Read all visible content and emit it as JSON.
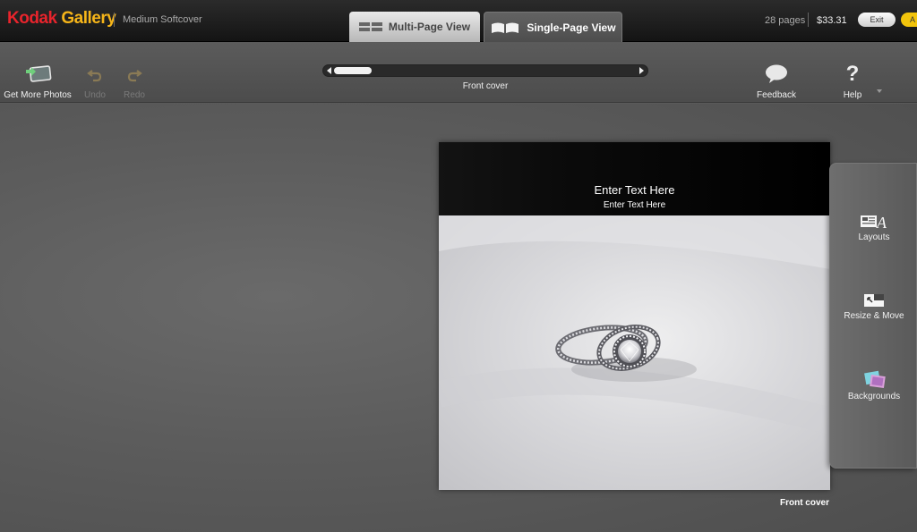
{
  "header": {
    "brand_primary": "Kodak",
    "brand_secondary": "Gallery",
    "brand_primary_color": "#e8242c",
    "brand_secondary_color": "#f6b519",
    "product": "Medium Softcover",
    "tabs": [
      {
        "label": "Multi-Page View",
        "icon": "grid-icon",
        "active": false
      },
      {
        "label": "Single-Page View",
        "icon": "open-book-icon",
        "active": true
      }
    ],
    "pages": "28 pages",
    "price": "$33.31",
    "exit_label": "Exit",
    "edge_label": "A"
  },
  "toolbar": {
    "get_more_photos": "Get More Photos",
    "undo": "Undo",
    "redo": "Redo",
    "feedback": "Feedback",
    "help": "Help",
    "current_page": "Front cover"
  },
  "page": {
    "title_placeholder": "Enter Text Here",
    "subtitle_placeholder": "Enter Text Here",
    "label": "Front cover"
  },
  "side_panel": {
    "layouts": "Layouts",
    "resize_move": "Resize & Move",
    "backgrounds": "Backgrounds"
  }
}
